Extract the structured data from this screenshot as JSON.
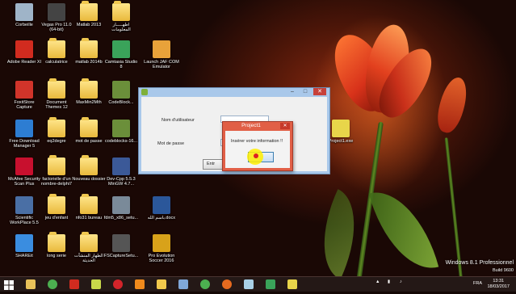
{
  "desktop": {
    "icons": [
      {
        "label": "Corbeille",
        "icon": "recycle-bin-icon"
      },
      {
        "label": "Vegas Pro 11.0\n(64-bit)",
        "icon": "vegas-icon"
      },
      {
        "label": "Matlab 2013",
        "icon": "folder-icon"
      },
      {
        "label": "اطهـــــار\nالمعلومات",
        "icon": "folder-icon"
      },
      {
        "label": "Adobe Reader XI",
        "icon": "acrobat-icon"
      },
      {
        "label": "calculatrice",
        "icon": "folder-icon"
      },
      {
        "label": "matlab 2014b",
        "icon": "folder-icon"
      },
      {
        "label": "Camtasia Studio\n8",
        "icon": "camtasia-icon"
      },
      {
        "label": "Launch JAF COM\nEmulator",
        "icon": "emulator-icon"
      },
      {
        "label": "FoxitStore\nCapture",
        "icon": "foxit-icon"
      },
      {
        "label": "Document\nThemes 12",
        "icon": "folder-icon"
      },
      {
        "label": "MaxMin2Mth",
        "icon": "folder-icon"
      },
      {
        "label": "CodeBlock...",
        "icon": "codeblocks-icon"
      },
      {
        "label": "Free Download\nManager 5",
        "icon": "download-manager-icon"
      },
      {
        "label": "eq2degre",
        "icon": "folder-icon"
      },
      {
        "label": "mot de passe",
        "icon": "folder-icon"
      },
      {
        "label": "codeblocks-16...",
        "icon": "codeblocks-icon"
      },
      {
        "label": "McAfee Security\nScan Plus",
        "icon": "mcafee-icon"
      },
      {
        "label": "factorielle d'un\nnombre-delphi7",
        "icon": "folder-icon"
      },
      {
        "label": "Nouveau dossier",
        "icon": "folder-icon"
      },
      {
        "label": "Dev-Cpp 5.5.3\nMinGW 4.7...",
        "icon": "devcpp-icon"
      },
      {
        "label": "Scientific\nWorkPlace 5.5",
        "icon": "swp-icon"
      },
      {
        "label": "jeu d'enfant",
        "icon": "folder-icon"
      },
      {
        "label": "nfo31 bureau",
        "icon": "folder-icon"
      },
      {
        "label": "fdm5_x86_setu...",
        "icon": "setup-icon"
      },
      {
        "label": "باسم الله.docx",
        "icon": "word-doc-icon"
      },
      {
        "label": "SHAREit",
        "icon": "shareit-icon"
      },
      {
        "label": "long serie",
        "icon": "folder-icon"
      },
      {
        "label": "الطهار المنشآت\nالحديثة",
        "icon": "folder-icon"
      },
      {
        "label": "FSCaptureSetu...",
        "icon": "fscapture-setup-icon"
      },
      {
        "label": "Pro Evolution\nSoccer 2016",
        "icon": "pes-icon"
      },
      {
        "label": "Project1.exe",
        "icon": "delphi7-exe-icon"
      }
    ]
  },
  "app_window": {
    "username_label": "Nom d'utilisateur",
    "password_label": "Mot de passe",
    "enter_button": "Entr",
    "min": "–",
    "max": "□",
    "close": "✕"
  },
  "dialog": {
    "title": "Project1",
    "close": "✕",
    "message": "Insérer votre information !!",
    "ok_label": ""
  },
  "watermark": {
    "line1": "Windows 8.1 Professionnel",
    "line2": "Build 9600"
  },
  "taskbar": {
    "language": "FRA",
    "time": "13:31",
    "date": "18/03/2017",
    "items": [
      "file-explorer-icon",
      "chrome-icon",
      "acrobat-icon",
      "delphi-icon",
      "opera-icon",
      "vlc-icon",
      "folder-icon",
      "paint-icon",
      "chrome-icon",
      "firefox-icon",
      "notepad-icon",
      "camtasia-icon",
      "project1-icon"
    ]
  },
  "colors": {
    "dialog_accent": "#e15f46",
    "window_frame": "#a9c8ea",
    "taskbar": "#261a18"
  }
}
